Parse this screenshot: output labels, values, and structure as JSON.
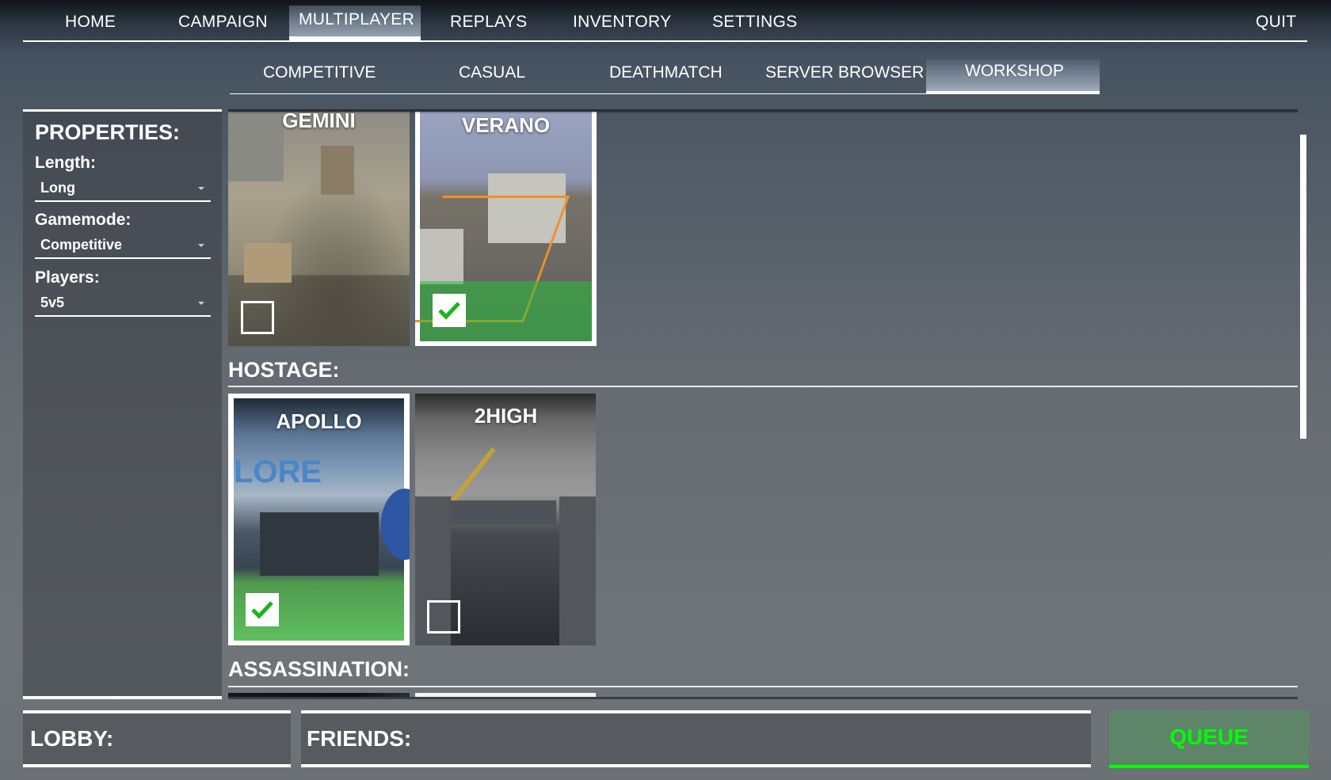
{
  "topnav": {
    "items": [
      {
        "label": "HOME"
      },
      {
        "label": "CAMPAIGN"
      },
      {
        "label": "MULTIPLAYER",
        "active": true
      },
      {
        "label": "REPLAYS"
      },
      {
        "label": "INVENTORY"
      },
      {
        "label": "SETTINGS"
      }
    ],
    "quit": "QUIT"
  },
  "subnav": {
    "items": [
      {
        "label": "COMPETITIVE"
      },
      {
        "label": "CASUAL"
      },
      {
        "label": "DEATHMATCH"
      },
      {
        "label": "SERVER BROWSER"
      },
      {
        "label": "WORKSHOP",
        "active": true
      }
    ]
  },
  "properties": {
    "title": "PROPERTIES:",
    "fields": [
      {
        "label": "Length:",
        "value": "Long"
      },
      {
        "label": "Gamemode:",
        "value": "Competitive"
      },
      {
        "label": "Players:",
        "value": "5v5"
      }
    ]
  },
  "sections": [
    {
      "title": "",
      "maps": [
        {
          "name": "GEMINI",
          "selected": false
        },
        {
          "name": "VERANO",
          "selected": true
        }
      ]
    },
    {
      "title": "HOSTAGE:",
      "maps": [
        {
          "name": "APOLLO",
          "selected": true
        },
        {
          "name": "2HIGH",
          "selected": false
        }
      ]
    },
    {
      "title": "ASSASSINATION:",
      "maps": []
    }
  ],
  "bottom": {
    "lobby": "LOBBY:",
    "friends": "FRIENDS:",
    "queue": "QUEUE"
  },
  "colors": {
    "accent_green": "#00ff00",
    "check_green": "#1db31d"
  }
}
